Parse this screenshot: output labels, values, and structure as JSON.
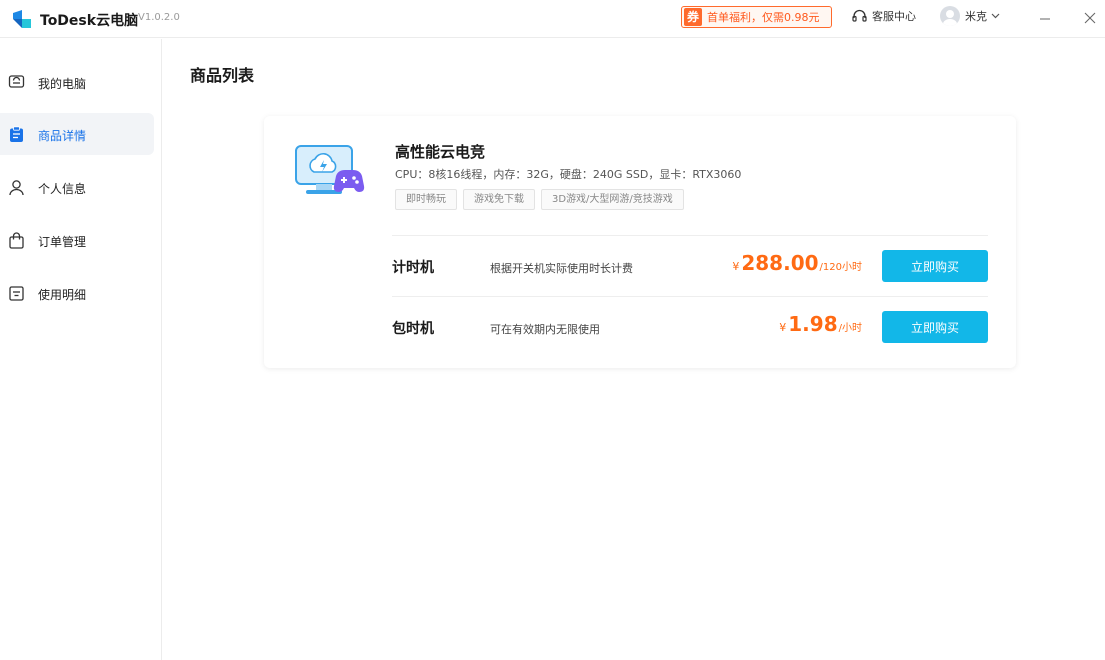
{
  "app": {
    "name": "ToDesk云电脑",
    "version": "V1.0.2.0"
  },
  "titlebar": {
    "promo_badge": "券",
    "promo_text": "首单福利，仅需0.98元",
    "support_label": "客服中心",
    "user_name": "米克"
  },
  "sidebar": {
    "items": [
      {
        "label": "我的电脑",
        "icon": "monitor-icon"
      },
      {
        "label": "商品详情",
        "icon": "clipboard-icon"
      },
      {
        "label": "个人信息",
        "icon": "person-icon"
      },
      {
        "label": "订单管理",
        "icon": "bag-icon"
      },
      {
        "label": "使用明细",
        "icon": "list-detail-icon"
      }
    ],
    "active_index": 1
  },
  "main": {
    "title": "商品列表",
    "product": {
      "name": "高性能云电竞",
      "spec": "CPU：8核16线程，内存：32G，硬盘：240G SSD，显卡：RTX3060",
      "tags": [
        "即时畅玩",
        "游戏免下载",
        "3D游戏/大型网游/竞技游戏"
      ],
      "plans": [
        {
          "title": "计时机",
          "desc": "根据开关机实际使用时长计费",
          "currency": "¥",
          "price": "288.00",
          "unit": "/120小时",
          "button": "立即购买"
        },
        {
          "title": "包时机",
          "desc": "可在有效期内无限使用",
          "currency": "¥",
          "price": "1.98",
          "unit": "/小时",
          "button": "立即购买"
        }
      ]
    }
  },
  "colors": {
    "accent": "#12b7e8",
    "price": "#ff6a13",
    "active_nav": "#1a73e8",
    "promo": "#ff6a2c"
  }
}
